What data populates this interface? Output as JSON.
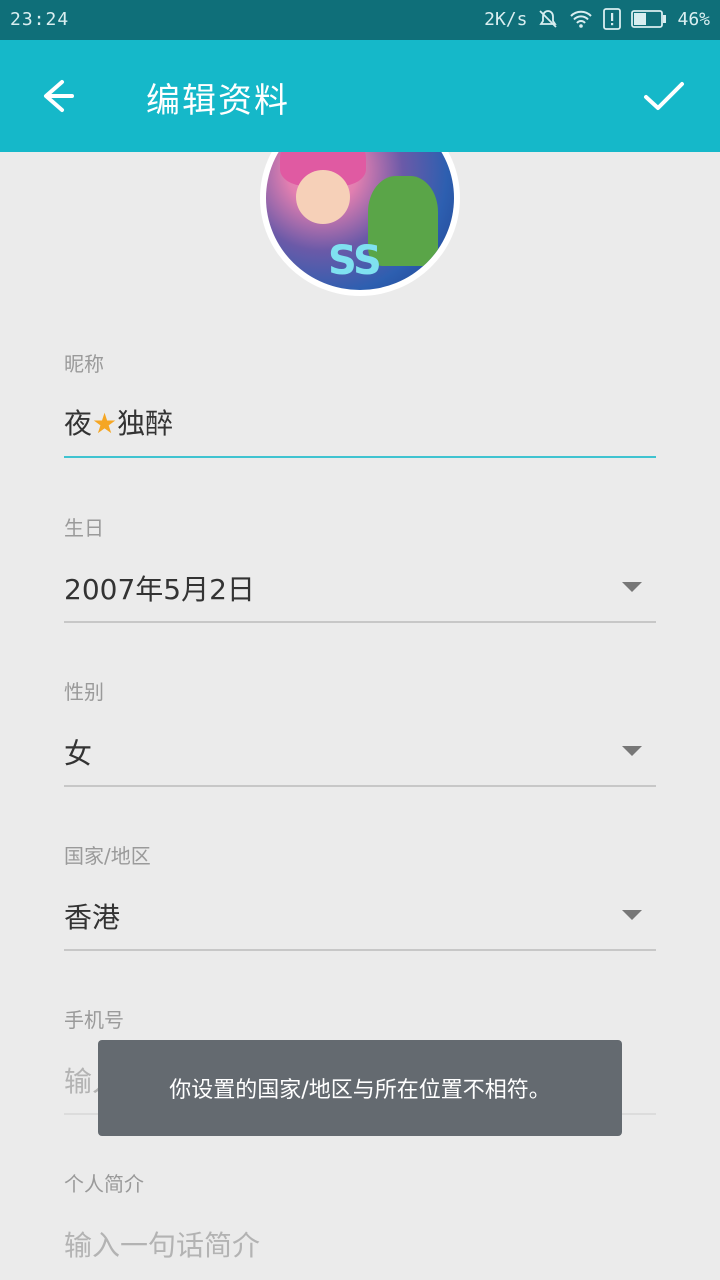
{
  "status_bar": {
    "time": "23:24",
    "net_speed": "2K/s",
    "battery_pct": "46%",
    "battery_level": 0.46
  },
  "toolbar": {
    "title": "编辑资料",
    "back_icon": "arrow-left-icon",
    "confirm_icon": "check-icon"
  },
  "form": {
    "nickname": {
      "label": "昵称",
      "value_part1": "夜",
      "value_part2": "独醉"
    },
    "birthday": {
      "label": "生日",
      "value": "2007年5月2日"
    },
    "gender": {
      "label": "性别",
      "value": "女"
    },
    "region": {
      "label": "国家/地区",
      "value": "香港"
    },
    "phone": {
      "label": "手机号",
      "placeholder": "输入手机号"
    },
    "bio": {
      "label": "个人简介",
      "placeholder": "输入一句话简介"
    }
  },
  "toast": {
    "message": "你设置的国家/地区与所在位置不相符。"
  },
  "colors": {
    "toolbar": "#15b8c9",
    "status_bar": "#0f6f79",
    "accent_underline": "#3fc3d0"
  }
}
